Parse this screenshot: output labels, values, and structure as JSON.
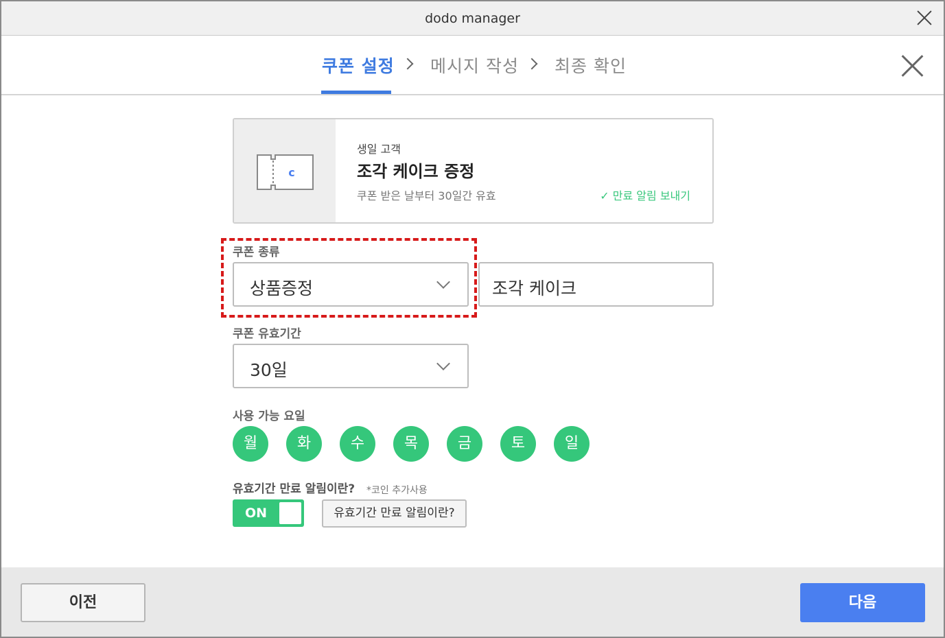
{
  "window": {
    "title": "dodo manager"
  },
  "steps": [
    {
      "label": "쿠폰 설정",
      "active": true
    },
    {
      "label": "메시지 작성",
      "active": false
    },
    {
      "label": "최종 확인",
      "active": false
    }
  ],
  "coupon_card": {
    "label": "생일 고객",
    "title": "조각 케이크 증정",
    "validity_text": "쿠폰 받은 날부터 30일간 유효",
    "expiry_alert_text": "만료 알림 보내기",
    "thumb_letter": "c"
  },
  "coupon_type": {
    "label": "쿠폰 종류",
    "selected": "상품증정",
    "product_value": "조각 케이크"
  },
  "coupon_validity": {
    "label": "쿠폰 유효기간",
    "selected": "30일"
  },
  "usable_days": {
    "label": "사용 가능 요일",
    "days": [
      "월",
      "화",
      "수",
      "목",
      "금",
      "토",
      "일"
    ]
  },
  "expiry_alert": {
    "question": "유효기간 만료 알림이란?",
    "note": "*코인 추가사용",
    "toggle_label": "ON",
    "help_button": "유효기간 만료 알림이란?"
  },
  "footer": {
    "prev_label": "이전",
    "next_label": "다음"
  },
  "colors": {
    "accent_blue": "#3f7be0",
    "primary_button": "#4a7ff0",
    "green": "#35c77b",
    "highlight_red": "#d71a1a"
  }
}
